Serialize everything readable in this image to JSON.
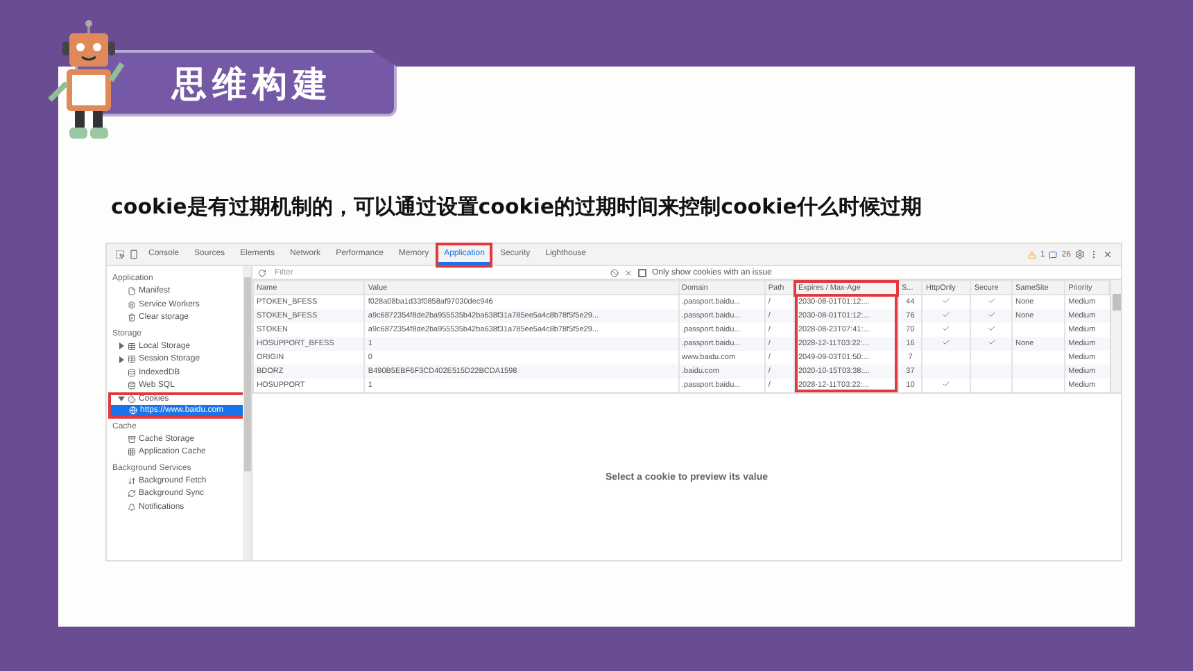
{
  "banner": {
    "title": "思维构建"
  },
  "heading": "cookie是有过期机制的，可以通过设置cookie的过期时间来控制cookie什么时候过期",
  "devtools": {
    "tabs": [
      {
        "label": "Console",
        "selected": false,
        "highlighted": false
      },
      {
        "label": "Sources",
        "selected": false,
        "highlighted": false
      },
      {
        "label": "Elements",
        "selected": false,
        "highlighted": false
      },
      {
        "label": "Network",
        "selected": false,
        "highlighted": false
      },
      {
        "label": "Performance",
        "selected": false,
        "highlighted": false
      },
      {
        "label": "Memory",
        "selected": false,
        "highlighted": false
      },
      {
        "label": "Application",
        "selected": true,
        "highlighted": true
      },
      {
        "label": "Security",
        "selected": false,
        "highlighted": false
      },
      {
        "label": "Lighthouse",
        "selected": false,
        "highlighted": false
      }
    ],
    "warnings": "1",
    "messages": "26",
    "sidebar": [
      {
        "title": "Application",
        "items": [
          {
            "label": "Manifest"
          },
          {
            "label": "Service Workers"
          },
          {
            "label": "Clear storage"
          }
        ]
      },
      {
        "title": "Storage",
        "items": [
          {
            "label": "Local Storage",
            "expanded": false
          },
          {
            "label": "Session Storage",
            "expanded": false
          },
          {
            "label": "IndexedDB"
          },
          {
            "label": "Web SQL"
          },
          {
            "label": "Cookies",
            "expanded": true,
            "highlighted": true,
            "children": [
              {
                "label": "https://www.baidu.com",
                "selected": true
              }
            ]
          }
        ]
      },
      {
        "title": "Cache",
        "items": [
          {
            "label": "Cache Storage"
          },
          {
            "label": "Application Cache"
          }
        ]
      },
      {
        "title": "Background Services",
        "items": [
          {
            "label": "Background Fetch"
          },
          {
            "label": "Background Sync"
          },
          {
            "label": "Notifications"
          }
        ]
      }
    ],
    "filter": {
      "placeholder": "Filter"
    },
    "issue_filter": {
      "label": "Only show cookies with an issue",
      "checked": false
    },
    "columns": [
      {
        "label": "Name",
        "highlighted": false
      },
      {
        "label": "Value",
        "highlighted": false
      },
      {
        "label": "Domain",
        "highlighted": false
      },
      {
        "label": "Path",
        "highlighted": false
      },
      {
        "label": "Expires / Max-Age",
        "highlighted": true
      },
      {
        "label": "S...",
        "highlighted": false
      },
      {
        "label": "HttpOnly",
        "highlighted": false
      },
      {
        "label": "Secure",
        "highlighted": false
      },
      {
        "label": "SameSite",
        "highlighted": false
      },
      {
        "label": "Priority",
        "highlighted": false
      }
    ],
    "rows": [
      {
        "name": "PTOKEN_BFESS",
        "value": "f028a08ba1d33f0858af97030dec946",
        "domain": ".passport.baidu...",
        "path": "/",
        "expires": "2030-08-01T01:12:...",
        "size": "44",
        "http_only": true,
        "secure": true,
        "same_site": "None",
        "priority": "Medium"
      },
      {
        "name": "STOKEN_BFESS",
        "value": "a9c6872354f8de2ba955535b42ba638f31a785ee5a4c8b78f5f5e29...",
        "domain": ".passport.baidu...",
        "path": "/",
        "expires": "2030-08-01T01:12:...",
        "size": "76",
        "http_only": true,
        "secure": true,
        "same_site": "None",
        "priority": "Medium"
      },
      {
        "name": "STOKEN",
        "value": "a9c6872354f8de2ba955535b42ba638f31a785ee5a4c8b78f5f5e29...",
        "domain": ".passport.baidu...",
        "path": "/",
        "expires": "2028-08-23T07:41:...",
        "size": "70",
        "http_only": true,
        "secure": true,
        "same_site": "",
        "priority": "Medium"
      },
      {
        "name": "HOSUPPORT_BFESS",
        "value": "1",
        "domain": ".passport.baidu...",
        "path": "/",
        "expires": "2028-12-11T03:22:...",
        "size": "16",
        "http_only": true,
        "secure": true,
        "same_site": "None",
        "priority": "Medium"
      },
      {
        "name": "ORIGIN",
        "value": "0",
        "domain": "www.baidu.com",
        "path": "/",
        "expires": "2049-09-03T01:50:...",
        "size": "7",
        "http_only": false,
        "secure": false,
        "same_site": "",
        "priority": "Medium"
      },
      {
        "name": "BDORZ",
        "value": "B490B5EBF6F3CD402E515D22BCDA1598",
        "domain": ".baidu.com",
        "path": "/",
        "expires": "2020-10-15T03:38:...",
        "size": "37",
        "http_only": false,
        "secure": false,
        "same_site": "",
        "priority": "Medium"
      },
      {
        "name": "HOSUPPORT",
        "value": "1",
        "domain": ".passport.baidu...",
        "path": "/",
        "expires": "2028-12-11T03:22:...",
        "size": "10",
        "http_only": true,
        "secure": false,
        "same_site": "",
        "priority": "Medium"
      }
    ],
    "preview": "Select a cookie to preview its value"
  }
}
